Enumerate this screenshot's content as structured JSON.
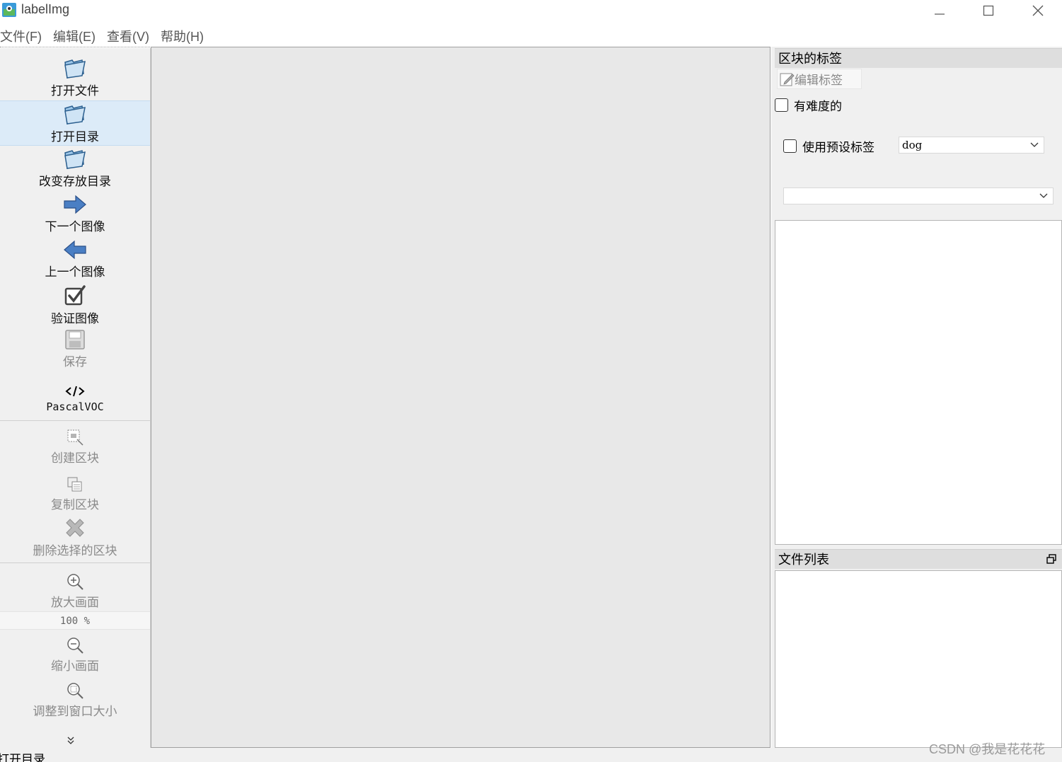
{
  "window": {
    "title": "labelImg",
    "icon": "labelimg-app-icon"
  },
  "menu": [
    "文件(F)",
    "编辑(E)",
    "查看(V)",
    "帮助(H)"
  ],
  "toolbar": {
    "open_file": "打开文件",
    "open_dir": "打开目录",
    "change_save_dir": "改变存放目录",
    "next_image": "下一个图像",
    "prev_image": "上一个图像",
    "verify_image": "验证图像",
    "save": "保存",
    "format": "PascalVOC",
    "create_box": "创建区块",
    "duplicate_box": "复制区块",
    "delete_box": "删除选择的区块",
    "zoom_in": "放大画面",
    "zoom_level": "100 %",
    "zoom_out": "缩小画面",
    "fit_window": "调整到窗口大小"
  },
  "right_panel": {
    "box_labels_title": "区块的标签",
    "edit_label_button": "编辑标签",
    "difficult_label": "有难度的",
    "use_default_label": "使用预设标签",
    "default_label_value": "dog",
    "label_combo_value": "",
    "file_list_title": "文件列表"
  },
  "status": {
    "message": "打开目录",
    "watermark": "CSDN @我是花花花"
  },
  "colors": {
    "canvas_bg": "#e8e8e8",
    "panel_bg": "#f0f0f0",
    "hover_bg": "#dcebf8",
    "dock_title_bg": "#dedede"
  }
}
